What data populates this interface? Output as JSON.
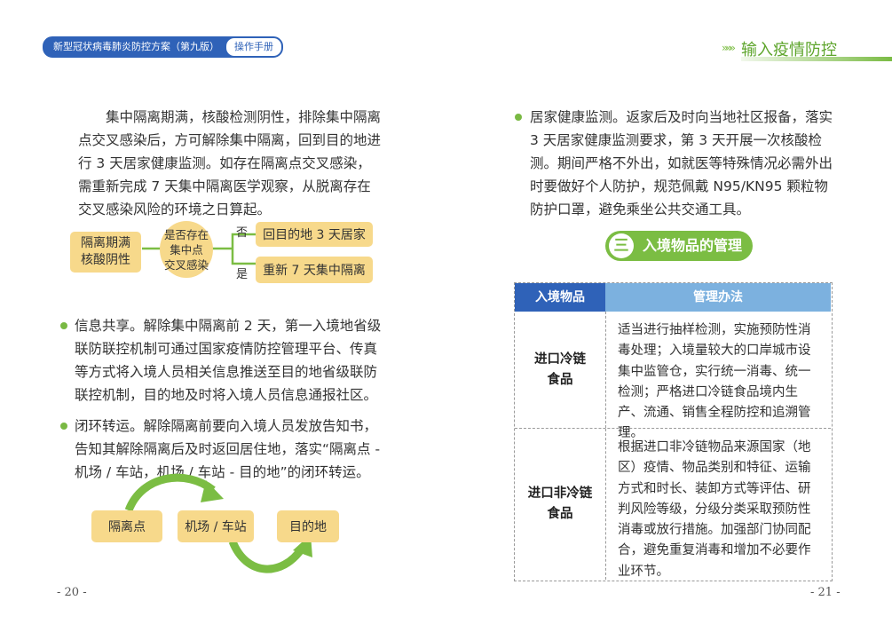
{
  "header": {
    "book_title": "新型冠状病毒肺炎防控方案（第九版）",
    "book_tag": "操作手册",
    "chapter_arrows": "»»»",
    "chapter_title": "输入疫情防控"
  },
  "left": {
    "intro_paragraph": "集中隔离期满，核酸检测阴性，排除集中隔离点交叉感染后，方可解除集中隔离，回到目的地进行 3 天居家健康监测。如存在隔离点交叉感染，需重新完成 7 天集中隔离医学观察，从脱离存在交叉感染风险的环境之日算起。",
    "flow1": {
      "start": "隔离期满\n核酸阴性",
      "decision": "是否存在\n集中点\n交叉感染",
      "no_label": "否",
      "yes_label": "是",
      "no_result": "回目的地 3 天居家",
      "yes_result": "重新 7 天集中隔离"
    },
    "bullet1": "信息共享。解除集中隔离前 2 天，第一入境地省级联防联控机制可通过国家疫情防控管理平台、传真等方式将入境人员相关信息推送至目的地省级联防联控机制，目的地及时将入境人员信息通报社区。",
    "bullet2": "闭环转运。解除隔离前要向入境人员发放告知书，告知其解除隔离后及时返回居住地，落实“隔离点 - 机场 / 车站，机场 / 车站 - 目的地”的闭环转运。",
    "flow2": {
      "step1": "隔离点",
      "step2": "机场 / 车站",
      "step3": "目的地"
    },
    "page_number": "- 20 -"
  },
  "right": {
    "bullet3": "居家健康监测。返家后及时向当地社区报备，落实 3 天居家健康监测要求，第 3 天开展一次核酸检测。期间严格不外出，如就医等特殊情况必需外出时要做好个人防护，规范佩戴 N95/KN95 颗粒物防护口罩，避免乘坐公共交通工具。",
    "section": {
      "number": "三",
      "title": "入境物品的管理"
    },
    "table": {
      "headers": [
        "入境物品",
        "管理办法"
      ],
      "rows": [
        {
          "item": "进口冷链\n食品",
          "method": "适当进行抽样检测，实施预防性消毒处理；入境量较大的口岸城市设集中监管仓，实行统一消毒、统一检测；严格进口冷链食品境内生产、流通、销售全程防控和追溯管理。"
        },
        {
          "item": "进口非冷链\n食品",
          "method": "根据进口非冷链物品来源国家（地区）疫情、物品类别和特征、运输方式和时长、装卸方式等评估、研判风险等级，分级分类采取预防性消毒或放行措施。加强部门协同配合，避免重复消毒和增加不必要作业环节。"
        }
      ]
    },
    "page_number": "- 21 -"
  },
  "colors": {
    "brand_blue": "#2f62b8",
    "green": "#7bbd43",
    "yellow_box": "#f7d98b",
    "header_light_blue": "#7cb1df"
  }
}
